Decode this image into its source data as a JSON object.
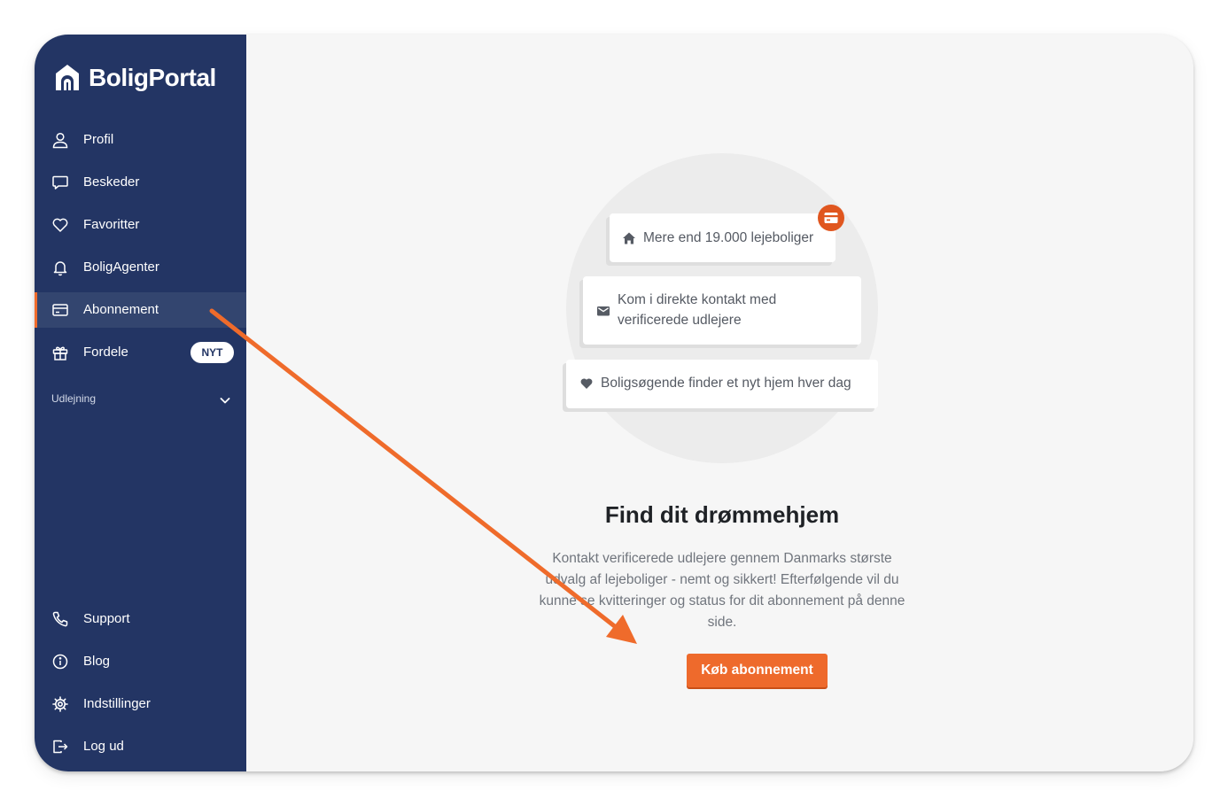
{
  "brand": {
    "name": "BoligPortal"
  },
  "sidebar": {
    "items": [
      {
        "label": "Profil",
        "icon": "user-icon"
      },
      {
        "label": "Beskeder",
        "icon": "message-icon"
      },
      {
        "label": "Favoritter",
        "icon": "heart-icon"
      },
      {
        "label": "BoligAgenter",
        "icon": "bell-icon"
      },
      {
        "label": "Abonnement",
        "icon": "credit-card-icon",
        "active": true
      },
      {
        "label": "Fordele",
        "icon": "gift-icon",
        "badge": "NYT"
      }
    ],
    "section": {
      "label": "Udlejning",
      "icon": "chevron-down-icon"
    },
    "bottom_items": [
      {
        "label": "Support",
        "icon": "phone-icon"
      },
      {
        "label": "Blog",
        "icon": "info-icon"
      },
      {
        "label": "Indstillinger",
        "icon": "gear-icon"
      },
      {
        "label": "Log ud",
        "icon": "logout-icon"
      }
    ]
  },
  "main": {
    "features": [
      {
        "text": "Mere end 19.000 lejeboliger",
        "icon": "home-icon"
      },
      {
        "text": "Kom i direkte kontakt med verificerede udlejere",
        "icon": "envelope-icon"
      },
      {
        "text": "Boligsøgende finder et nyt hjem hver dag",
        "icon": "heart-icon"
      }
    ],
    "headline": "Find dit drømmehjem",
    "description": "Kontakt verificerede udlejere gennem Danmarks største udvalg af lejeboliger - nemt og sikkert! Efterfølgende vil du kunne se kvitteringer og status for dit abonnement på denne side.",
    "cta_label": "Køb abonnement"
  },
  "colors": {
    "sidebar_bg": "#233564",
    "active_item_bg": "#33456f",
    "accent_orange": "#ee6a2c",
    "arrow_orange": "#ef6b2b",
    "main_bg": "#f6f6f6"
  }
}
